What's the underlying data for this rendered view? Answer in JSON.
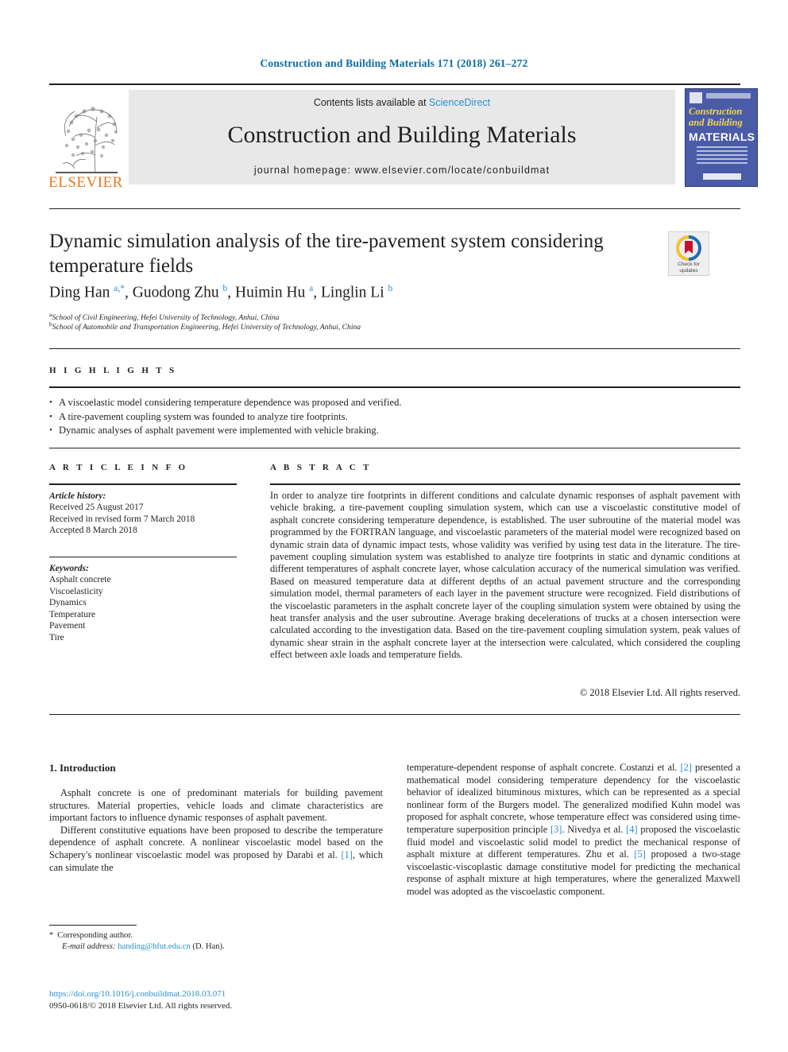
{
  "running_head": "Construction and Building Materials 171 (2018) 261–272",
  "masthead": {
    "contents_prefix": "Contents lists available at ",
    "sciencedirect": "ScienceDirect",
    "journal_name": "Construction and Building Materials",
    "homepage": "journal homepage: www.elsevier.com/locate/conbuildmat",
    "publisher_logo": "elsevier-tree-logo",
    "publisher_wordmark": "ELSEVIER",
    "cover": {
      "line1": "Construction",
      "line2": "and Building",
      "line3": "MATERIALS"
    }
  },
  "article": {
    "title": "Dynamic simulation analysis of the tire-pavement system considering temperature fields",
    "crossmark": {
      "line1": "Check for",
      "line2": "updates"
    },
    "authors_html": "Ding Han <sup>a,*</sup>, Guodong Zhu <sup>b</sup>, Huimin Hu <sup>a</sup>, Linglin Li <sup>b</sup>",
    "affiliations": [
      {
        "marker": "a",
        "text": "School of Civil Engineering, Hefei University of Technology, Anhui, China"
      },
      {
        "marker": "b",
        "text": "School of Automobile and Transportation Engineering, Hefei University of Technology, Anhui, China"
      }
    ]
  },
  "highlights": {
    "label": "H I G H L I G H T S",
    "items": [
      "A viscoelastic model considering temperature dependence was proposed and verified.",
      "A tire-pavement coupling system was founded to analyze tire footprints.",
      "Dynamic analyses of asphalt pavement were implemented with vehicle braking."
    ]
  },
  "article_info": {
    "label": "A R T I C L E   I N F O",
    "history_label": "Article history:",
    "history": [
      "Received 25 August 2017",
      "Received in revised form 7 March 2018",
      "Accepted 8 March 2018"
    ],
    "keywords_label": "Keywords:",
    "keywords": [
      "Asphalt concrete",
      "Viscoelasticity",
      "Dynamics",
      "Temperature",
      "Pavement",
      "Tire"
    ]
  },
  "abstract": {
    "label": "A B S T R A C T",
    "text": "In order to analyze tire footprints in different conditions and calculate dynamic responses of asphalt pavement with vehicle braking, a tire-pavement coupling simulation system, which can use a viscoelastic constitutive model of asphalt concrete considering temperature dependence, is established. The user subroutine of the material model was programmed by the FORTRAN language, and viscoelastic parameters of the material model were recognized based on dynamic strain data of dynamic impact tests, whose validity was verified by using test data in the literature. The tire-pavement coupling simulation system was established to analyze tire footprints in static and dynamic conditions at different temperatures of asphalt concrete layer, whose calculation accuracy of the numerical simulation was verified. Based on measured temperature data at different depths of an actual pavement structure and the corresponding simulation model, thermal parameters of each layer in the pavement structure were recognized. Field distributions of the viscoelastic parameters in the asphalt concrete layer of the coupling simulation system were obtained by using the heat transfer analysis and the user subroutine. Average braking decelerations of trucks at a chosen intersection were calculated according to the investigation data. Based on the tire-pavement coupling simulation system, peak values of dynamic shear strain in the asphalt concrete layer at the intersection were calculated, which considered the coupling effect between axle loads and temperature fields.",
    "copyright": "© 2018 Elsevier Ltd. All rights reserved."
  },
  "body": {
    "section_heading": "1. Introduction",
    "left_paragraph_1": "Asphalt concrete is one of predominant materials for building pavement structures. Material properties, vehicle loads and climate characteristics are important factors to influence dynamic responses of asphalt pavement.",
    "left_paragraph_2_part1": "Different constitutive equations have been proposed to describe the temperature dependence of asphalt concrete. A nonlinear viscoelastic model based on the Schapery's nonlinear viscoelastic model was proposed by Darabi et al. ",
    "left_paragraph_2_ref": "[1]",
    "left_paragraph_2_part2": ", which can simulate the",
    "right_part1": "temperature-dependent response of asphalt concrete. Costanzi et al. ",
    "right_ref1": "[2]",
    "right_part2": " presented a mathematical model considering temperature dependency for the viscoelastic behavior of idealized bituminous mixtures, which can be represented as a special nonlinear form of the Burgers model. The generalized modified Kuhn model was proposed for asphalt concrete, whose temperature effect was considered using time-temperature superposition principle ",
    "right_ref2": "[3]",
    "right_part3": ". Nivedya et al. ",
    "right_ref3": "[4]",
    "right_part4": " proposed the viscoelastic fluid model and viscoelastic solid model to predict the mechanical response of asphalt mixture at different temperatures. Zhu et al. ",
    "right_ref4": "[5]",
    "right_part5": " proposed a two-stage viscoelastic-viscoplastic damage constitutive model for predicting the mechanical response of asphalt mixture at high temperatures, where the generalized Maxwell model was adopted as the viscoelastic component."
  },
  "footer": {
    "corresponding_marker": "*",
    "corresponding_label": "Corresponding author.",
    "email_label": "E-mail address:",
    "email": "handing@hfut.edu.cn",
    "email_suffix": " (D. Han).",
    "doi": "https://doi.org/10.1016/j.conbuildmat.2018.03.071",
    "issn_line": "0950-0618/© 2018 Elsevier Ltd. All rights reserved."
  },
  "colors": {
    "link_blue": "#2b8fd0",
    "header_blue": "#0b6ba4",
    "elsevier_orange": "#e87722",
    "banner_gray": "#e8e8e8",
    "cover_blue": "#4a5ba8",
    "cover_yellow": "#f2d64b"
  }
}
